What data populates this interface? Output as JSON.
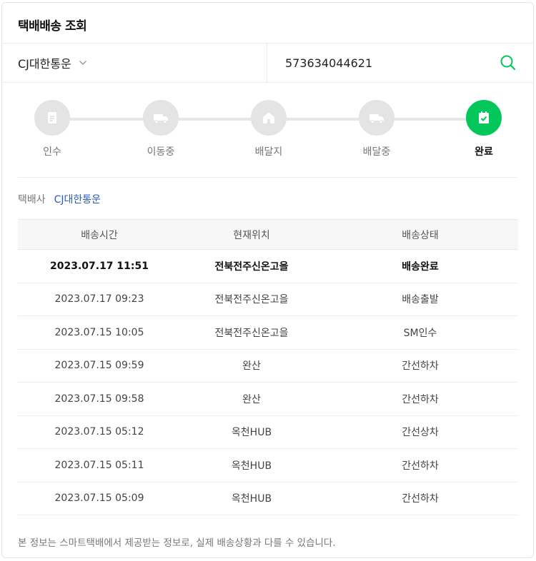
{
  "page": {
    "title": "택배배송 조회"
  },
  "search": {
    "carrier": "CJ대한통운",
    "tracking_number": "573634044621"
  },
  "steps": [
    {
      "label": "인수",
      "icon": "document-icon",
      "active": false
    },
    {
      "label": "이동중",
      "icon": "truck-icon",
      "active": false
    },
    {
      "label": "배달지",
      "icon": "house-icon",
      "active": false
    },
    {
      "label": "배달중",
      "icon": "truck-icon",
      "active": false
    },
    {
      "label": "완료",
      "icon": "check-clipboard-icon",
      "active": true
    }
  ],
  "carrier_info": {
    "key": "택배사",
    "value": "CJ대한통운"
  },
  "table": {
    "headers": [
      "배송시간",
      "현재위치",
      "배송상태"
    ],
    "rows": [
      [
        "2023.07.17 11:51",
        "전북전주신온고을",
        "배송완료"
      ],
      [
        "2023.07.17 09:23",
        "전북전주신온고을",
        "배송출발"
      ],
      [
        "2023.07.15 10:05",
        "전북전주신온고을",
        "SM인수"
      ],
      [
        "2023.07.15 09:59",
        "완산",
        "간선하차"
      ],
      [
        "2023.07.15 09:58",
        "완산",
        "간선하차"
      ],
      [
        "2023.07.15 05:12",
        "옥천HUB",
        "간선상차"
      ],
      [
        "2023.07.15 05:11",
        "옥천HUB",
        "간선하차"
      ],
      [
        "2023.07.15 05:09",
        "옥천HUB",
        "간선하차"
      ]
    ]
  },
  "notice": "본 정보는 스마트택배에서 제공받는 정보로, 실제 배송상황과 다를 수 있습니다.",
  "colors": {
    "accent": "#03c75a",
    "link": "#2a5bb5",
    "inactive": "#e4e4e4"
  }
}
